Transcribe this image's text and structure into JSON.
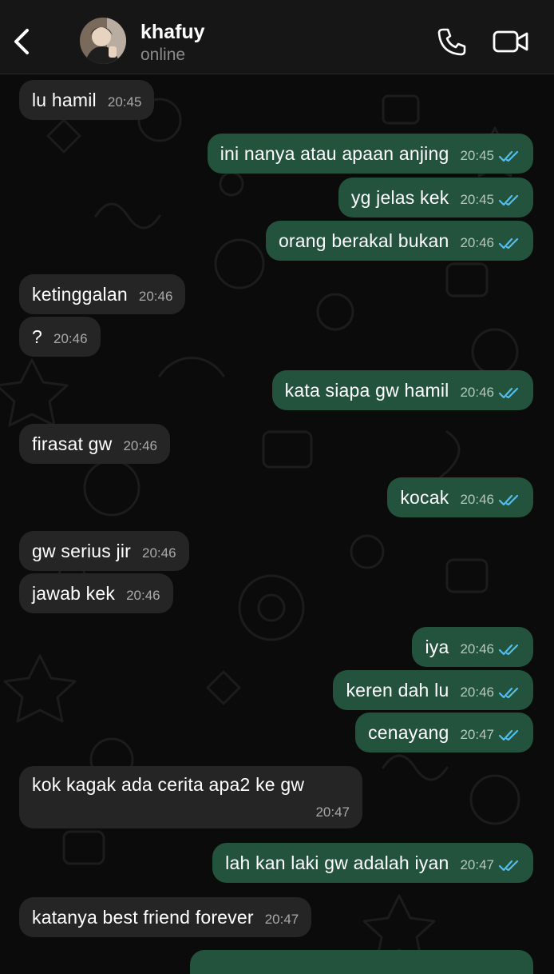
{
  "header": {
    "contact_name": "khafuy",
    "status": "online"
  },
  "messages": [
    {
      "dir": "in",
      "text": "lu hamil",
      "time": "20:45"
    },
    {
      "dir": "out",
      "text": "ini nanya atau apaan anjing",
      "time": "20:45",
      "read": true
    },
    {
      "dir": "out",
      "text": "yg jelas kek",
      "time": "20:45",
      "read": true
    },
    {
      "dir": "out",
      "text": "orang berakal bukan",
      "time": "20:46",
      "read": true
    },
    {
      "dir": "in",
      "text": "ketinggalan",
      "time": "20:46"
    },
    {
      "dir": "in",
      "text": "?",
      "time": "20:46"
    },
    {
      "dir": "out",
      "text": "kata siapa gw hamil",
      "time": "20:46",
      "read": true
    },
    {
      "dir": "in",
      "text": "firasat gw",
      "time": "20:46"
    },
    {
      "dir": "out",
      "text": "kocak",
      "time": "20:46",
      "read": true
    },
    {
      "dir": "in",
      "text": "gw serius jir",
      "time": "20:46"
    },
    {
      "dir": "in",
      "text": "jawab kek",
      "time": "20:46"
    },
    {
      "dir": "out",
      "text": "iya",
      "time": "20:46",
      "read": true
    },
    {
      "dir": "out",
      "text": "keren dah lu",
      "time": "20:46",
      "read": true
    },
    {
      "dir": "out",
      "text": "cenayang",
      "time": "20:47",
      "read": true
    },
    {
      "dir": "in",
      "text": "kok kagak ada cerita apa2 ke gw",
      "time": "20:47"
    },
    {
      "dir": "out",
      "text": "lah kan laki gw adalah iyan",
      "time": "20:47",
      "read": true
    },
    {
      "dir": "in",
      "text": "katanya best friend forever",
      "time": "20:47"
    }
  ],
  "colors": {
    "incoming_bubble": "#252525",
    "outgoing_bubble": "#23533d",
    "read_ticks": "#53bdeb",
    "background": "#0b0b0b"
  },
  "icons": [
    "back-chevron-icon",
    "phone-icon",
    "video-camera-icon",
    "double-check-icon"
  ]
}
